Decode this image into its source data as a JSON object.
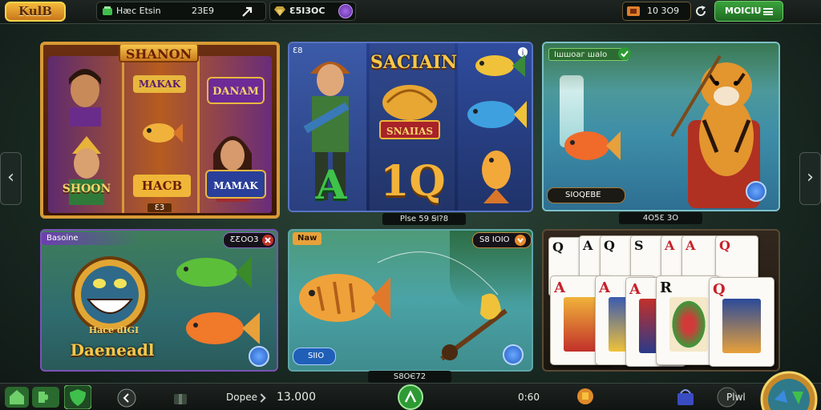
{
  "topbar": {
    "logo": "KulB",
    "balance_label": "Hæc Etsin",
    "balance_value": "2ЗE9",
    "gems_value": "Ɛ5I3OⅭ",
    "coins_value": "10 3O9",
    "menu_label": "MOICIU"
  },
  "cards": {
    "slot1": {
      "title": "SHANON",
      "sym1": "MAKAK",
      "sym2": "DANAM",
      "sym3": "SHOON",
      "sym4": "HACB",
      "sym5": "MAMAK",
      "footer": "Ɛ3"
    },
    "slot2": {
      "title": "SACIAIN",
      "sym_badge": "SNAIIAS",
      "big_a": "A",
      "big_q": "1Q",
      "corner": "Ɛ8",
      "caption": "Рlse 59 ꞨI?8"
    },
    "fishing1": {
      "tag": "Iшшоаг шаIо",
      "pill": "SIOQEBE",
      "caption": "4O5Ɛ 3O"
    },
    "fishing2": {
      "tag": "Basoine",
      "price": "ƸƸOO3",
      "title_top": "Hace dIGI",
      "title_main": "Daeneadl"
    },
    "fishing3": {
      "tag": "Naw",
      "price": "S8 IOIO",
      "pill": "SIIO",
      "caption": "S8OЄ72"
    },
    "cards": {
      "ranks_top": [
        "Q",
        "A",
        "Q",
        "S",
        "A",
        "A",
        "Q"
      ],
      "ranks_bottom": [
        "A",
        "A",
        "A",
        "R",
        "Q"
      ]
    }
  },
  "bottombar": {
    "label": "Dopee",
    "amount": "13.000",
    "timer": "0:60",
    "right_label": "Plwl"
  },
  "colors": {
    "accent_green": "#2e9a34",
    "gold": "#d89a34",
    "topbar_bg": "#141916"
  }
}
